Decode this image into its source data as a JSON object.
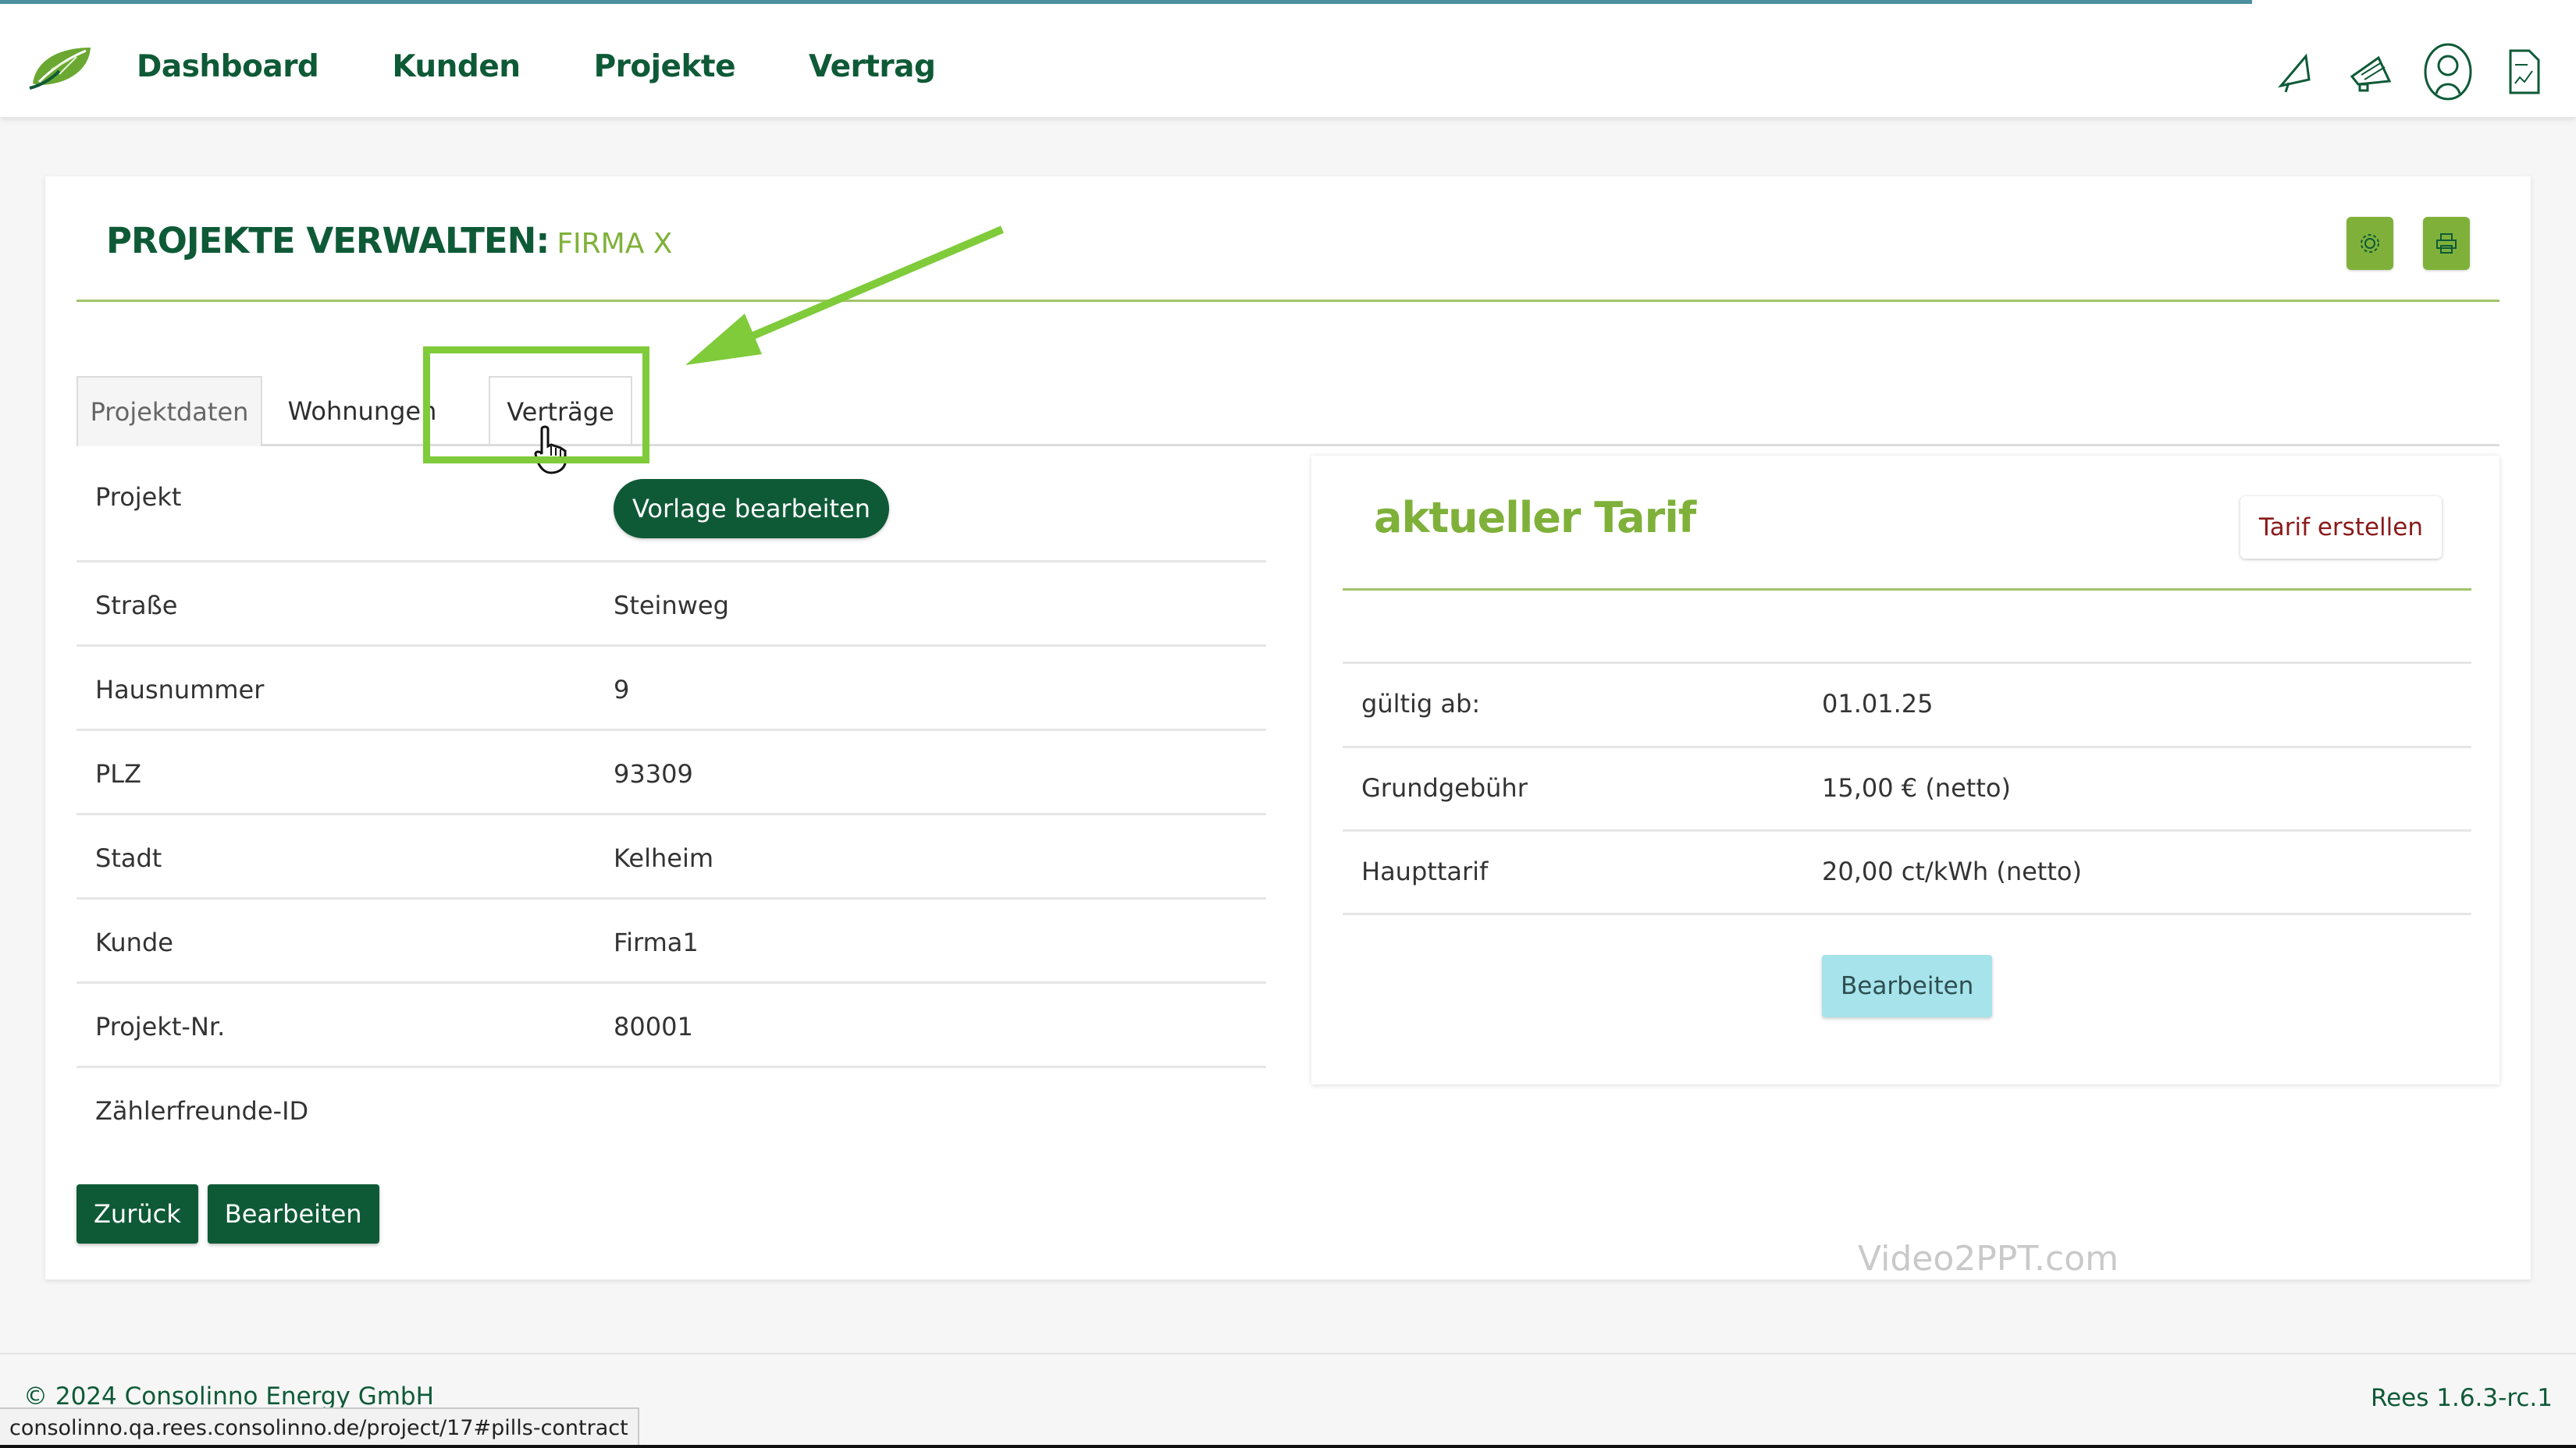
{
  "nav": {
    "items": [
      "Dashboard",
      "Kunden",
      "Projekte",
      "Vertrag"
    ]
  },
  "header": {
    "title": "PROJEKTE VERWALTEN:",
    "subtitle": "FIRMA X"
  },
  "tabs": [
    "Projektdaten",
    "Wohnungen",
    "Verträge"
  ],
  "project": {
    "vorlage_button": "Vorlage bearbeiten",
    "rows": [
      {
        "label": "Projekt",
        "value": ""
      },
      {
        "label": "Straße",
        "value": "Steinweg"
      },
      {
        "label": "Hausnummer",
        "value": "9"
      },
      {
        "label": "PLZ",
        "value": "93309"
      },
      {
        "label": "Stadt",
        "value": "Kelheim"
      },
      {
        "label": "Kunde",
        "value": "Firma1"
      },
      {
        "label": "Projekt-Nr.",
        "value": "80001"
      },
      {
        "label": "Zählerfreunde-ID",
        "value": ""
      }
    ],
    "back_button": "Zurück",
    "edit_button": "Bearbeiten"
  },
  "tarif": {
    "title": "aktueller Tarif",
    "create_button": "Tarif erstellen",
    "rows": [
      {
        "label": "gültig ab:",
        "value": "01.01.25"
      },
      {
        "label": "Grundgebühr",
        "value": "15,00 € (netto)"
      },
      {
        "label": "Haupttarif",
        "value": "20,00 ct/kWh (netto)"
      }
    ],
    "edit_button": "Bearbeiten"
  },
  "watermark": "Video2PPT.com",
  "footer": {
    "copyright": "© 2024 Consolinno Energy GmbH",
    "version": "Rees 1.6.3-rc.1"
  },
  "status_url": "consolinno.qa.rees.consolinno.de/project/17#pills-contract",
  "colors": {
    "brand_dark": "#0e5a37",
    "brand_light": "#7fb13a",
    "highlight": "#7fcb3a",
    "tarif_edit": "#a6e3ea"
  },
  "icons": [
    "leaf-logo-icon",
    "bell-icon",
    "megaphone-icon",
    "user-profile-icon",
    "document-icon",
    "settings-icon",
    "print-icon",
    "hand-cursor-icon",
    "annotation-arrow-icon"
  ]
}
